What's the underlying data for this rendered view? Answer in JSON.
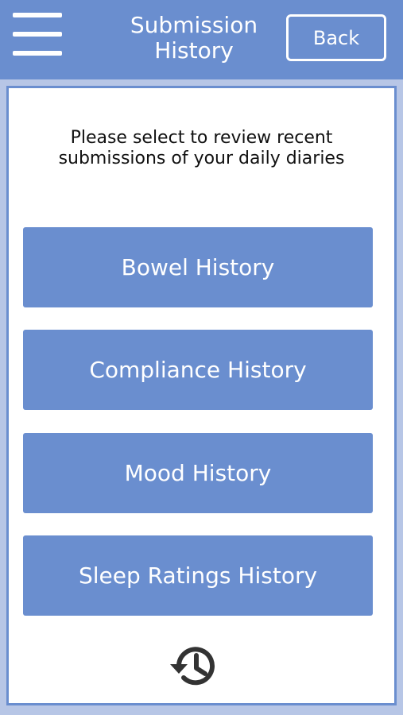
{
  "header": {
    "title_line1": "Submission",
    "title_line2": "History",
    "back_label": "Back",
    "menu_icon": "hamburger-menu-icon"
  },
  "content": {
    "instructions_line1": "Please select to review recent",
    "instructions_line2": "submissions of your daily diaries",
    "buttons": [
      {
        "label": "Bowel History"
      },
      {
        "label": "Compliance History"
      },
      {
        "label": "Mood History"
      },
      {
        "label": "Sleep Ratings History"
      }
    ],
    "footer_icon": "history-icon"
  },
  "colors": {
    "primary": "#6a8ecf",
    "background": "#b7c6e6",
    "panel": "#ffffff",
    "text": "#111111",
    "icon": "#333333"
  }
}
